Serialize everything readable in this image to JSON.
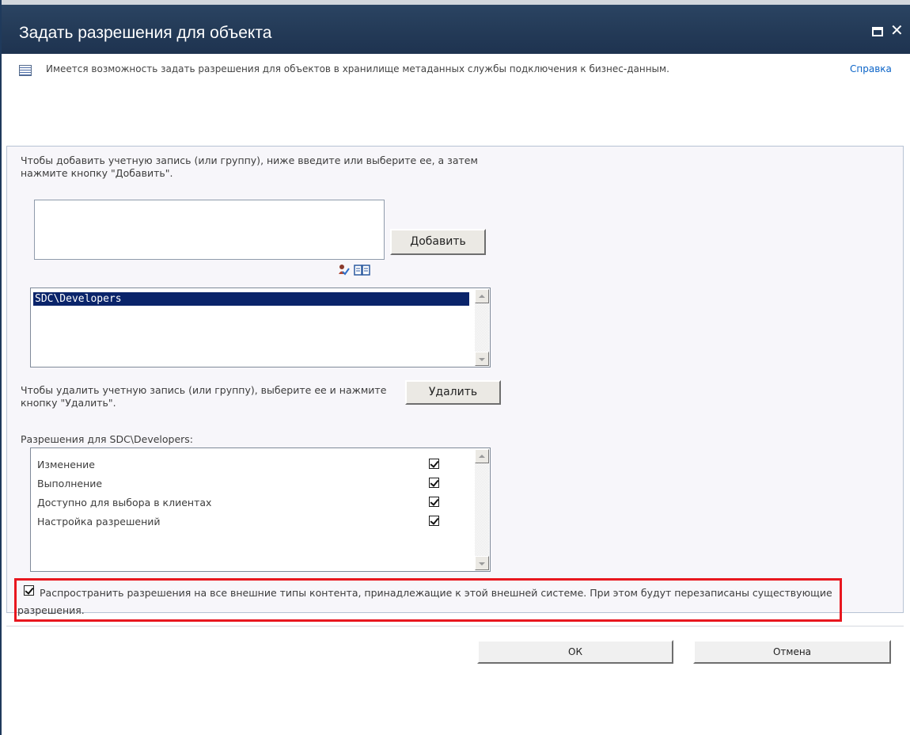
{
  "dialog": {
    "title": "Задать разрешения для объекта"
  },
  "info": {
    "text": "Имеется возможность задать разрешения для объектов в хранилище метаданных службы подключения к бизнес-данным.",
    "help_link": "Справка"
  },
  "add_section": {
    "instructions": "Чтобы добавить учетную запись (или группу), ниже введите или выберите ее, а затем нажмите кнопку \"Добавить\".",
    "input_value": "",
    "add_button": "Добавить"
  },
  "accounts": {
    "items": [
      "SDC\\Developers"
    ],
    "selected": "SDC\\Developers"
  },
  "remove_section": {
    "instructions": "Чтобы удалить учетную запись (или группу), выберите ее и нажмите кнопку \"Удалить\".",
    "remove_button": "Удалить"
  },
  "permissions": {
    "heading": "Разрешения для SDC\\Developers:",
    "items": [
      {
        "label": "Изменение",
        "checked": true
      },
      {
        "label": "Выполнение",
        "checked": true
      },
      {
        "label": "Доступно для выбора в клиентах",
        "checked": true
      },
      {
        "label": "Настройка разрешений",
        "checked": true
      }
    ]
  },
  "propagate": {
    "checked": true,
    "text": "Распространить разрешения на все внешние типы контента, принадлежащие к этой внешней системе. При этом будут перезаписаны существующие разрешения."
  },
  "footer": {
    "ok_button": "ОК",
    "cancel_button": "Отмена"
  },
  "colors": {
    "titlebar": "#243b58",
    "selection": "#0a246a",
    "highlight": "#e8171f",
    "link": "#0b64c8"
  },
  "icons": [
    "maximize-icon",
    "close-icon",
    "list-info-icon",
    "check-names-icon",
    "address-book-icon",
    "checkbox-checked-icon"
  ]
}
